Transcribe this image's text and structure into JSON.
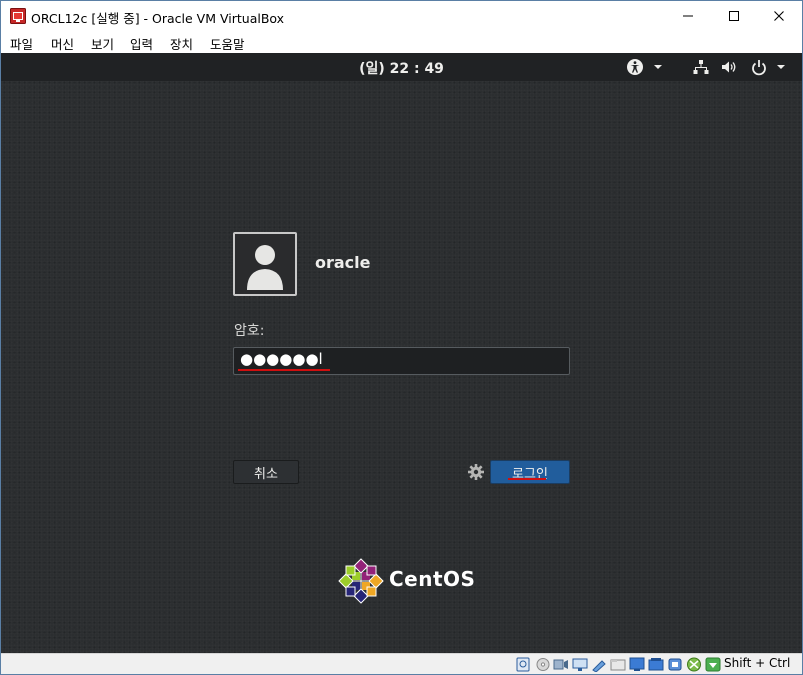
{
  "window": {
    "title": "ORCL12c [실행 중] - Oracle VM VirtualBox",
    "icons": {
      "app": "virtualbox-icon",
      "minimize": "minimize-icon",
      "maximize": "maximize-icon",
      "close": "close-icon"
    }
  },
  "menubar": {
    "items": [
      "파일",
      "머신",
      "보기",
      "입력",
      "장치",
      "도움말"
    ]
  },
  "guest": {
    "topbar": {
      "clock": "(일) 22 : 49",
      "icons": [
        "accessibility-icon",
        "chevron-down-icon",
        "network-icon",
        "volume-icon",
        "power-icon",
        "chevron-down-icon"
      ]
    },
    "login": {
      "username": "oracle",
      "password_label": "암호:",
      "password_masked": "●●●●●●l",
      "cancel_label": "취소",
      "login_label": "로그인"
    },
    "branding": {
      "logo_text": "CentOS"
    }
  },
  "statusbar": {
    "icons": [
      "hard-disk-icon",
      "optical-drive-icon",
      "audio-icon",
      "network-adapter-icon",
      "usb-icon",
      "shared-folders-icon",
      "display-icon",
      "video-capture-icon",
      "cpu-icon",
      "mouse-integration-icon",
      "host-key-icon"
    ],
    "host_key": "Shift + Ctrl"
  },
  "colors": {
    "accent": "#215d9c",
    "annotation_red": "#d01010",
    "screen_bg": "#2b2e30",
    "topbar_bg": "#202224"
  }
}
